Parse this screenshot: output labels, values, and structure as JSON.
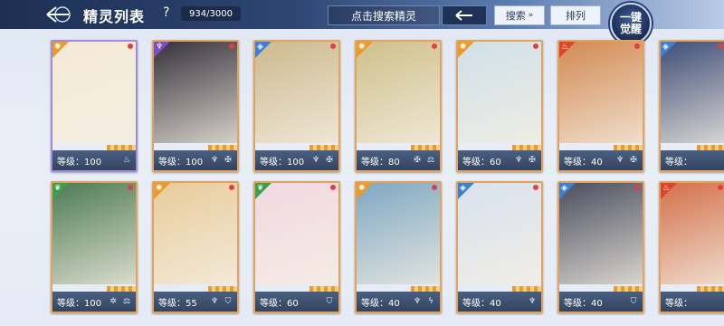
{
  "header": {
    "title": "精灵列表",
    "help": "?",
    "count": "934/3000",
    "search_label": "点击搜索精灵",
    "filter_label": "搜索",
    "sort_label": "排列",
    "awaken_label_1": "一键",
    "awaken_label_2": "觉醒"
  },
  "colors": {
    "header_dark": "#1d2f52",
    "card_gold": "#e3a35c",
    "card_purple": "#9f8bd8",
    "info_bar": "#4a5f82"
  },
  "cards": [
    {
      "level": "等级：100",
      "element": "light",
      "frame": "purple",
      "bg": "#f3ead6",
      "icons": [
        "tea-icon"
      ]
    },
    {
      "level": "等级：100",
      "element": "dark",
      "frame": "gold",
      "bg": "#35323c",
      "icons": [
        "trident-icon",
        "cross-icon"
      ]
    },
    {
      "level": "等级：100",
      "element": "water",
      "frame": "gold",
      "bg": "#cdb98e",
      "icons": [
        "trident-icon",
        "cross-icon"
      ]
    },
    {
      "level": "等级：80",
      "element": "light",
      "frame": "gold",
      "bg": "#cfc08a",
      "icons": [
        "cross-icon",
        "scale-icon"
      ]
    },
    {
      "level": "等级：60",
      "element": "light",
      "frame": "gold",
      "bg": "#cfe0e8",
      "icons": [
        "trident-icon",
        "cross-icon"
      ]
    },
    {
      "level": "等级：40",
      "element": "fire",
      "frame": "gold",
      "bg": "#d28a52",
      "icons": [
        "trident-icon",
        "cross-icon"
      ]
    },
    {
      "level": "等级：",
      "element": "water",
      "frame": "gold",
      "bg": "#3e4e78",
      "icons": []
    },
    {
      "level": "等级：100",
      "element": "wind",
      "frame": "gold",
      "bg": "#4d7b54",
      "icons": [
        "star-icon",
        "scale-icon"
      ]
    },
    {
      "level": "等级：55",
      "element": "light",
      "frame": "gold",
      "bg": "#e8cc9a",
      "icons": [
        "trident-icon",
        "shield-icon"
      ]
    },
    {
      "level": "等级：60",
      "element": "wind",
      "frame": "gold",
      "bg": "#f2d8e2",
      "icons": [
        "shield-icon"
      ]
    },
    {
      "level": "等级：40",
      "element": "light",
      "frame": "gold",
      "bg": "#7fa8c4",
      "icons": [
        "trident-icon",
        "bolt-icon"
      ]
    },
    {
      "level": "等级：40",
      "element": "water",
      "frame": "gold",
      "bg": "#d8e2ee",
      "icons": [
        "trident-icon"
      ]
    },
    {
      "level": "等级：40",
      "element": "water",
      "frame": "gold",
      "bg": "#4a4e5e",
      "icons": [
        "shield-icon"
      ]
    },
    {
      "level": "等级：",
      "element": "fire",
      "frame": "gold",
      "bg": "#d4704a",
      "icons": []
    }
  ]
}
